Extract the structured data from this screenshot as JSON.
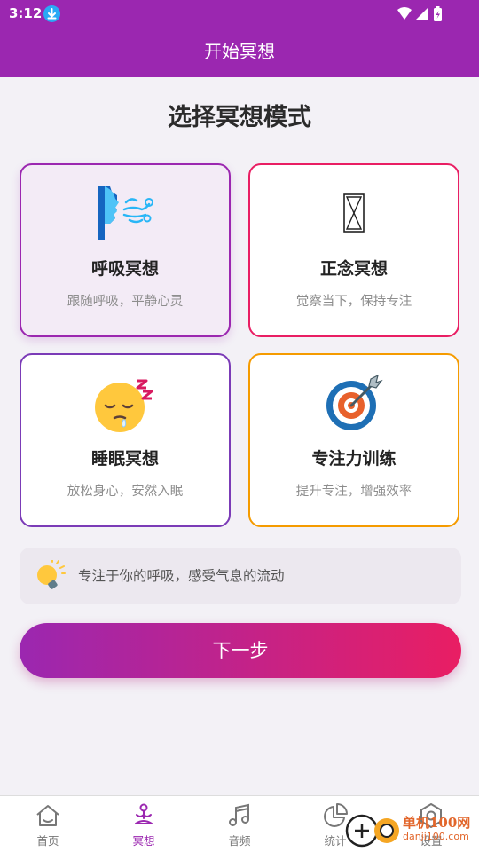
{
  "status_bar": {
    "time": "3:12"
  },
  "app_bar": {
    "title": "开始冥想"
  },
  "heading": "选择冥想模式",
  "modes": [
    {
      "name": "呼吸冥想",
      "desc": "跟随呼吸，平静心灵",
      "icon": "breathing-face-icon",
      "border": "#9b27b0",
      "selected": true
    },
    {
      "name": "正念冥想",
      "desc": "觉察当下，保持专注",
      "icon": "hourglass-icon",
      "border": "#e91e63",
      "selected": false
    },
    {
      "name": "睡眠冥想",
      "desc": "放松身心，安然入眠",
      "icon": "sleeping-face-icon",
      "border": "#7b3bb7",
      "selected": false
    },
    {
      "name": "专注力训练",
      "desc": "提升专注，增强效率",
      "icon": "target-dart-icon",
      "border": "#f59b00",
      "selected": false
    }
  ],
  "tip": {
    "text": "专注于你的呼吸，感受气息的流动",
    "icon": "lightbulb-icon"
  },
  "next_button": {
    "label": "下一步"
  },
  "nav": [
    {
      "label": "首页",
      "icon": "home-icon",
      "active": false
    },
    {
      "label": "冥想",
      "icon": "meditation-icon",
      "active": true
    },
    {
      "label": "音频",
      "icon": "music-note-icon",
      "active": false
    },
    {
      "label": "统计",
      "icon": "pie-chart-icon",
      "active": false
    },
    {
      "label": "设置",
      "icon": "gear-icon",
      "active": false
    }
  ],
  "watermark": {
    "text": "单机100网",
    "sub": "danji100.com"
  },
  "colors": {
    "primary": "#9b27b0",
    "accent": "#e91e63",
    "orange": "#f59b00"
  }
}
